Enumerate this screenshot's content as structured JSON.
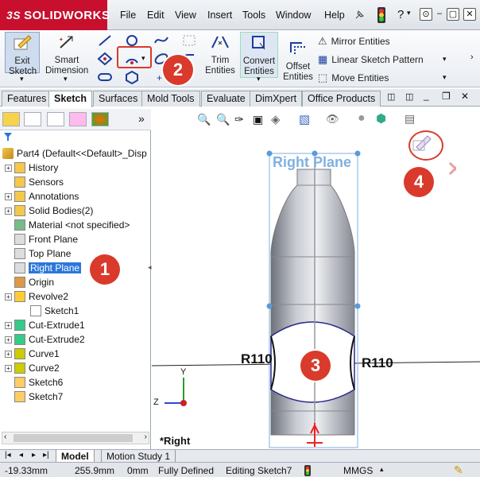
{
  "app": {
    "brand": "SOLIDWORKS",
    "brand_prefix": "3S"
  },
  "menu": [
    "File",
    "Edit",
    "View",
    "Insert",
    "Tools",
    "Window",
    "Help"
  ],
  "ribbon": {
    "exit_sketch": "Exit Sketch",
    "smart_dimension": "Smart Dimension",
    "trim_entities": "Trim Entities",
    "convert_entities": "Convert Entities",
    "offset_entities": "Offset Entities",
    "mirror_entities": "Mirror Entities",
    "linear_pattern": "Linear Sketch Pattern",
    "move_entities": "Move Entities"
  },
  "tabs": [
    "Features",
    "Sketch",
    "Surfaces",
    "Mold Tools",
    "Evaluate",
    "DimXpert",
    "Office Products"
  ],
  "tree": {
    "root": "Part4  (Default<<Default>_Disp",
    "items": [
      {
        "label": "History",
        "exp": true
      },
      {
        "label": "Sensors",
        "exp": false
      },
      {
        "label": "Annotations",
        "exp": true
      },
      {
        "label": "Solid Bodies(2)",
        "exp": true
      },
      {
        "label": "Material <not specified>",
        "exp": false
      },
      {
        "label": "Front Plane",
        "exp": false
      },
      {
        "label": "Top Plane",
        "exp": false
      },
      {
        "label": "Right Plane",
        "exp": false
      },
      {
        "label": "Origin",
        "exp": false
      },
      {
        "label": "Revolve2",
        "exp": true
      },
      {
        "label": "Sketch1",
        "exp": false
      },
      {
        "label": "Cut-Extrude1",
        "exp": true
      },
      {
        "label": "Cut-Extrude2",
        "exp": true
      },
      {
        "label": "Curve1",
        "exp": true
      },
      {
        "label": "Curve2",
        "exp": true
      },
      {
        "label": "Sketch6",
        "exp": false
      },
      {
        "label": "Sketch7",
        "exp": false
      }
    ]
  },
  "viewport": {
    "plane_label": "Right Plane",
    "dim_left": "R110",
    "dim_right": "R110",
    "view_name": "*Right",
    "axis_y": "Y",
    "axis_z": "Z"
  },
  "callouts": [
    "1",
    "2",
    "3",
    "4"
  ],
  "bottom_tabs": [
    "Model",
    "Motion Study 1"
  ],
  "status": {
    "x": "-19.33mm",
    "y": "255.9mm",
    "z": "0mm",
    "state": "Fully Defined",
    "editing": "Editing Sketch7",
    "units": "MMGS"
  },
  "colors": {
    "accent": "#c8102e",
    "callout": "#d93a2b",
    "selection": "#2c77d9",
    "sketch_line": "#1a1a8c"
  }
}
